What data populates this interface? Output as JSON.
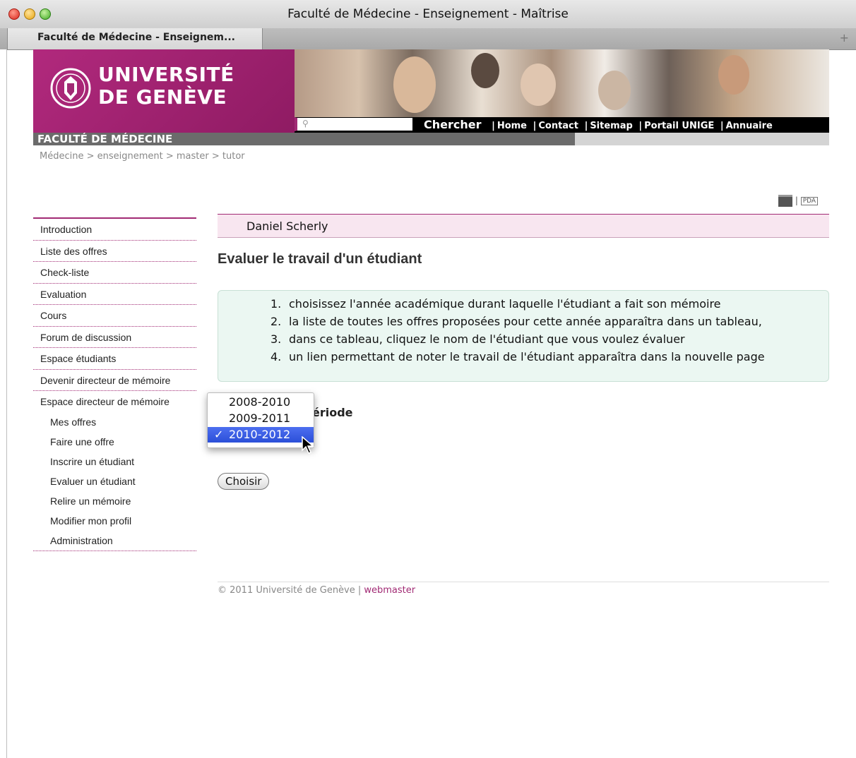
{
  "window": {
    "title": "Faculté de Médecine - Enseignement - Maîtrise"
  },
  "tab": {
    "label": "Faculté de Médecine - Enseignem...",
    "add": "+"
  },
  "header": {
    "university_line1": "UNIVERSITÉ",
    "university_line2": "DE GENÈVE",
    "faculty": "FACULTÉ DE MÉDECINE",
    "search_placeholder": "",
    "chercher": "Chercher",
    "links": [
      "Home",
      "Contact",
      "Sitemap",
      "Portail UNIGE",
      "Annuaire"
    ]
  },
  "breadcrumb": "Médecine > enseignement > master > tutor",
  "tools": {
    "separator": "|",
    "pda": "PDA"
  },
  "sidebar": {
    "items": [
      "Introduction",
      "Liste des offres",
      "Check-liste",
      "Evaluation",
      "Cours",
      "Forum de discussion",
      "Espace étudiants",
      "Devenir directeur de mémoire"
    ],
    "parent": "Espace directeur de mémoire",
    "subitems": [
      "Mes offres",
      "Faire une offre",
      "Inscrire un étudiant",
      "Evaluer un étudiant",
      "Relire un mémoire",
      "Modifier mon profil",
      "Administration"
    ]
  },
  "main": {
    "user": "Daniel Scherly",
    "title": "Evaluer le travail d'un étudiant",
    "instructions": [
      "choisissez l'année académique durant laquelle l'étudiant a fait son mémoire",
      "la liste de toutes les offres proposées pour cette année apparaîtra dans un tableau,",
      "dans ce tableau, cliquez le nom de l'étudiant que vous voulez évaluer",
      "un lien permettant de noter le travail de l'étudiant apparaîtra dans la nouvelle page"
    ],
    "periode_label_visible": "ériode",
    "choisir": "Choisir"
  },
  "dropdown": {
    "options": [
      "2008-2010",
      "2009-2011",
      "2010-2012"
    ],
    "selected": "2010-2012",
    "check": "✓"
  },
  "footer": {
    "copyright": "© 2011 Université de Genève | ",
    "webmaster": "webmaster"
  },
  "colors": {
    "brand": "#a12a74",
    "selection": "#2b4fd8",
    "instructions_bg": "#ebf7f2"
  }
}
